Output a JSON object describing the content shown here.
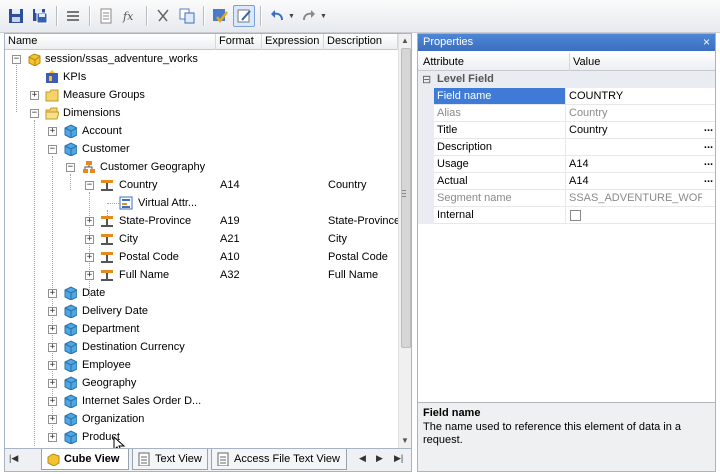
{
  "toolbar": {
    "buttons": [
      "save-icon",
      "save-all-icon",
      "split-icon",
      "properties-icon",
      "fx-icon",
      "cut-icon",
      "copy-icon",
      "validate-icon",
      "edit-mode-icon",
      "undo-icon",
      "redo-icon"
    ]
  },
  "grid": {
    "columns": [
      "Name",
      "Format",
      "Expression",
      "Description"
    ]
  },
  "tree": {
    "session": "session/ssas_adventure_works",
    "kpis": "KPIs",
    "measure_groups": "Measure Groups",
    "dimensions": "Dimensions",
    "account": "Account",
    "customer": "Customer",
    "customer_geography": "Customer Geography",
    "country": {
      "name": "Country",
      "format": "A14",
      "description": "Country"
    },
    "virtual_attr": "Virtual Attr...",
    "state_province": {
      "name": "State-Province",
      "format": "A19",
      "description": "State-Province"
    },
    "city": {
      "name": "City",
      "format": "A21",
      "description": "City"
    },
    "postal_code": {
      "name": "Postal Code",
      "format": "A10",
      "description": "Postal Code"
    },
    "full_name": {
      "name": "Full Name",
      "format": "A32",
      "description": "Full Name"
    },
    "date": "Date",
    "delivery_date": "Delivery Date",
    "department": "Department",
    "destination_currency": "Destination Currency",
    "employee": "Employee",
    "geography": "Geography",
    "internet_sales": "Internet Sales Order D...",
    "organization": "Organization",
    "product": "Product"
  },
  "tabs": {
    "cube_view": "Cube View",
    "text_view": "Text View",
    "access_file": "Access File Text View"
  },
  "properties": {
    "title": "Properties",
    "close": "×",
    "col_attribute": "Attribute",
    "col_value": "Value",
    "category": "Level Field",
    "category_toggle": "⊟",
    "rows": [
      {
        "name": "Field name",
        "value": "COUNTRY"
      },
      {
        "name": "Alias",
        "value": "Country"
      },
      {
        "name": "Title",
        "value": "Country",
        "ellipsis": "..."
      },
      {
        "name": "Description",
        "value": "",
        "ellipsis": "..."
      },
      {
        "name": "Usage",
        "value": "A14",
        "ellipsis": "..."
      },
      {
        "name": "Actual",
        "value": "A14",
        "ellipsis": "..."
      },
      {
        "name": "Segment name",
        "value": "SSAS_ADVENTURE_WORKS"
      },
      {
        "name": "Internal",
        "value": ""
      }
    ],
    "desc_title": "Field name",
    "desc_text": "The name used to reference this element of data in a request."
  }
}
